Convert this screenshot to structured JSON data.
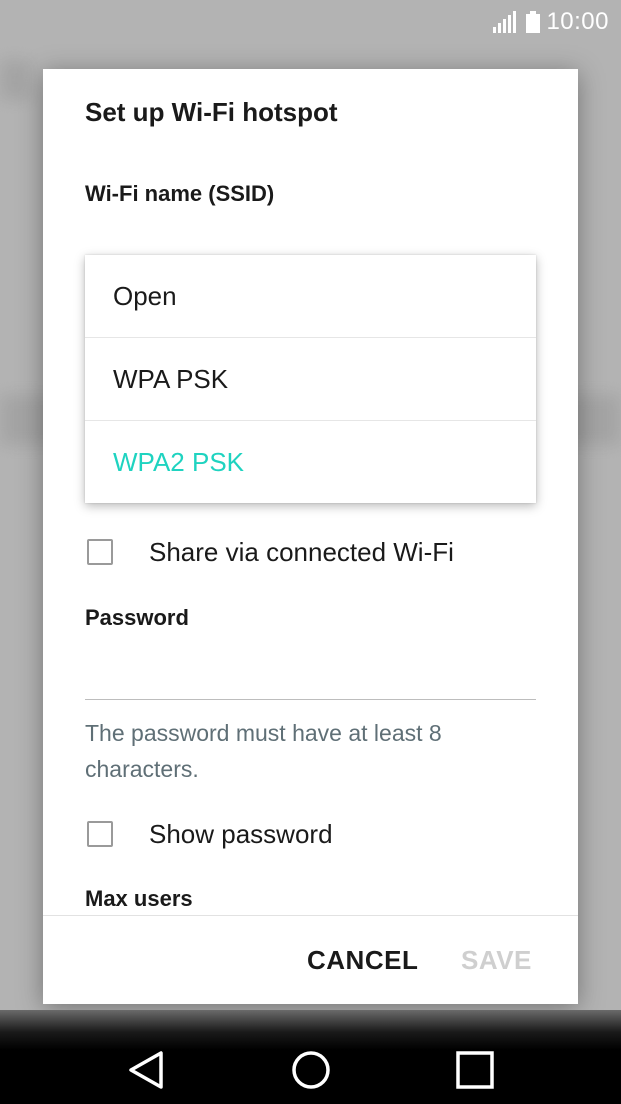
{
  "status_bar": {
    "time": "10:00",
    "icons": [
      "signal-icon",
      "battery-icon"
    ]
  },
  "dialog": {
    "title": "Set up Wi-Fi hotspot",
    "ssid_label": "Wi-Fi name (SSID)",
    "security_dropdown": {
      "options": [
        "Open",
        "WPA PSK",
        "WPA2 PSK"
      ],
      "selected": "WPA2 PSK",
      "selected_color": "#1fd3c0"
    },
    "share_checkbox": {
      "label": "Share via connected Wi-Fi",
      "checked": false
    },
    "password_label": "Password",
    "password_value": "",
    "password_hint": "The password must have at least 8 characters.",
    "show_password_checkbox": {
      "label": "Show password",
      "checked": false
    },
    "max_users_label": "Max users",
    "buttons": {
      "cancel": "CANCEL",
      "save": "SAVE"
    }
  },
  "nav_bar": {
    "icons": [
      "back-icon",
      "home-icon",
      "recent-apps-icon"
    ]
  }
}
